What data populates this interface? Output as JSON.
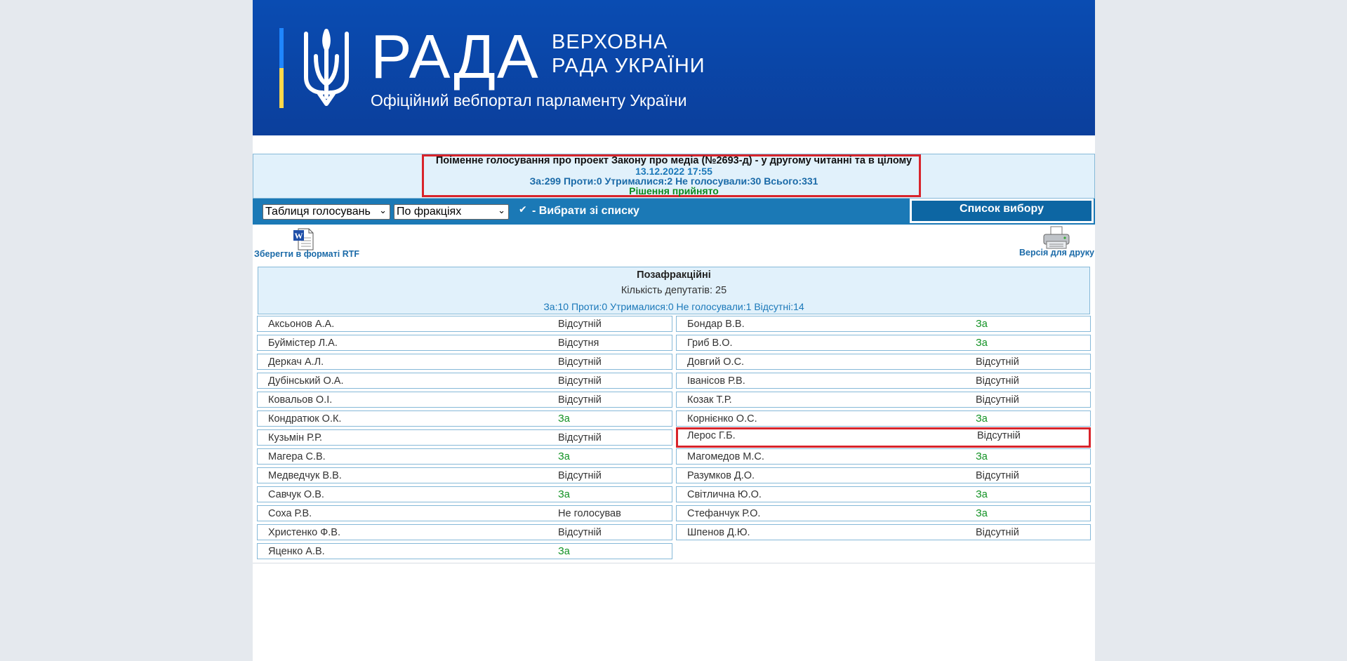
{
  "header": {
    "logo_word": "РАДА",
    "logo_sub1": "ВЕРХОВНА",
    "logo_sub2": "РАДА УКРАЇНИ",
    "tagline": "Офіційний вебпортал парламенту України"
  },
  "vote": {
    "title": "Поіменне голосування про проект Закону про медіа (№2693-д) - у другому читанні та в цілому",
    "datetime": "13.12.2022 17:55",
    "counts": "За:299 Проти:0 Утрималися:2 Не голосували:30 Всього:331",
    "decision": "Рішення прийнято"
  },
  "toolbar": {
    "view_select": "Таблиця голосувань",
    "group_select": "По фракціях",
    "choose_label": "- Вибрати зі списку",
    "choose_checked": true,
    "list_button": "Список вибору"
  },
  "actions": {
    "rtf_label": "Зберегти в форматі RTF",
    "print_label": "Версія для друку"
  },
  "fraction": {
    "name": "Позафракційні",
    "count": "Кількість депутатів: 25",
    "stats": "За:10 Проти:0 Утрималися:0 Не голосували:1 Відсутні:14"
  },
  "colors": {
    "header_blue": "#0a4cb2",
    "toolbar_blue": "#1b79b6",
    "highlight_red": "#d8242b",
    "vote_for_green": "#109122"
  },
  "deputies_left": [
    {
      "name": "Аксьонов А.А.",
      "vote": "Відсутній"
    },
    {
      "name": "Буймістер Л.А.",
      "vote": "Відсутня"
    },
    {
      "name": "Деркач А.Л.",
      "vote": "Відсутній"
    },
    {
      "name": "Дубінський О.А.",
      "vote": "Відсутній"
    },
    {
      "name": "Ковальов О.І.",
      "vote": "Відсутній"
    },
    {
      "name": "Кондратюк О.К.",
      "vote": "За"
    },
    {
      "name": "Кузьмін Р.Р.",
      "vote": "Відсутній"
    },
    {
      "name": "Магера С.В.",
      "vote": "За"
    },
    {
      "name": "Медведчук В.В.",
      "vote": "Відсутній"
    },
    {
      "name": "Савчук О.В.",
      "vote": "За"
    },
    {
      "name": "Соха Р.В.",
      "vote": "Не голосував"
    },
    {
      "name": "Христенко Ф.В.",
      "vote": "Відсутній"
    },
    {
      "name": "Яценко А.В.",
      "vote": "За"
    }
  ],
  "deputies_right": [
    {
      "name": "Бондар В.В.",
      "vote": "За"
    },
    {
      "name": "Гриб В.О.",
      "vote": "За"
    },
    {
      "name": "Довгий О.С.",
      "vote": "Відсутній"
    },
    {
      "name": "Іванісов Р.В.",
      "vote": "Відсутній"
    },
    {
      "name": "Козак Т.Р.",
      "vote": "Відсутній"
    },
    {
      "name": "Корнієнко О.С.",
      "vote": "За"
    },
    {
      "name": "Лерос Г.Б.",
      "vote": "Відсутній"
    },
    {
      "name": "Магомедов М.С.",
      "vote": "За"
    },
    {
      "name": "Разумков Д.О.",
      "vote": "Відсутній"
    },
    {
      "name": "Світлична Ю.О.",
      "vote": "За"
    },
    {
      "name": "Стефанчук Р.О.",
      "vote": "За"
    },
    {
      "name": "Шпенов Д.Ю.",
      "vote": "Відсутній"
    }
  ]
}
